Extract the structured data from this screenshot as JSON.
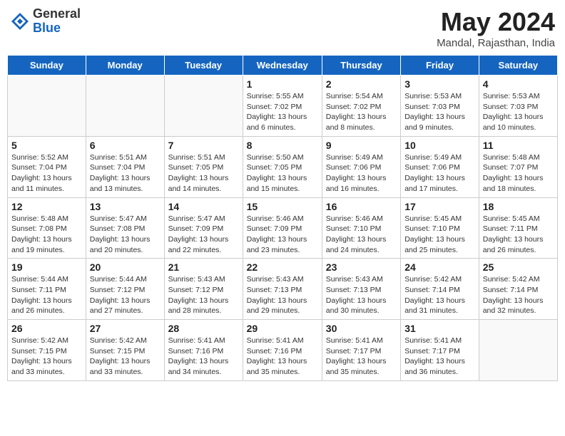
{
  "logo": {
    "general": "General",
    "blue": "Blue"
  },
  "header": {
    "month": "May 2024",
    "location": "Mandal, Rajasthan, India"
  },
  "weekdays": [
    "Sunday",
    "Monday",
    "Tuesday",
    "Wednesday",
    "Thursday",
    "Friday",
    "Saturday"
  ],
  "weeks": [
    [
      {
        "day": "",
        "info": ""
      },
      {
        "day": "",
        "info": ""
      },
      {
        "day": "",
        "info": ""
      },
      {
        "day": "1",
        "info": "Sunrise: 5:55 AM\nSunset: 7:02 PM\nDaylight: 13 hours\nand 6 minutes."
      },
      {
        "day": "2",
        "info": "Sunrise: 5:54 AM\nSunset: 7:02 PM\nDaylight: 13 hours\nand 8 minutes."
      },
      {
        "day": "3",
        "info": "Sunrise: 5:53 AM\nSunset: 7:03 PM\nDaylight: 13 hours\nand 9 minutes."
      },
      {
        "day": "4",
        "info": "Sunrise: 5:53 AM\nSunset: 7:03 PM\nDaylight: 13 hours\nand 10 minutes."
      }
    ],
    [
      {
        "day": "5",
        "info": "Sunrise: 5:52 AM\nSunset: 7:04 PM\nDaylight: 13 hours\nand 11 minutes."
      },
      {
        "day": "6",
        "info": "Sunrise: 5:51 AM\nSunset: 7:04 PM\nDaylight: 13 hours\nand 13 minutes."
      },
      {
        "day": "7",
        "info": "Sunrise: 5:51 AM\nSunset: 7:05 PM\nDaylight: 13 hours\nand 14 minutes."
      },
      {
        "day": "8",
        "info": "Sunrise: 5:50 AM\nSunset: 7:05 PM\nDaylight: 13 hours\nand 15 minutes."
      },
      {
        "day": "9",
        "info": "Sunrise: 5:49 AM\nSunset: 7:06 PM\nDaylight: 13 hours\nand 16 minutes."
      },
      {
        "day": "10",
        "info": "Sunrise: 5:49 AM\nSunset: 7:06 PM\nDaylight: 13 hours\nand 17 minutes."
      },
      {
        "day": "11",
        "info": "Sunrise: 5:48 AM\nSunset: 7:07 PM\nDaylight: 13 hours\nand 18 minutes."
      }
    ],
    [
      {
        "day": "12",
        "info": "Sunrise: 5:48 AM\nSunset: 7:08 PM\nDaylight: 13 hours\nand 19 minutes."
      },
      {
        "day": "13",
        "info": "Sunrise: 5:47 AM\nSunset: 7:08 PM\nDaylight: 13 hours\nand 20 minutes."
      },
      {
        "day": "14",
        "info": "Sunrise: 5:47 AM\nSunset: 7:09 PM\nDaylight: 13 hours\nand 22 minutes."
      },
      {
        "day": "15",
        "info": "Sunrise: 5:46 AM\nSunset: 7:09 PM\nDaylight: 13 hours\nand 23 minutes."
      },
      {
        "day": "16",
        "info": "Sunrise: 5:46 AM\nSunset: 7:10 PM\nDaylight: 13 hours\nand 24 minutes."
      },
      {
        "day": "17",
        "info": "Sunrise: 5:45 AM\nSunset: 7:10 PM\nDaylight: 13 hours\nand 25 minutes."
      },
      {
        "day": "18",
        "info": "Sunrise: 5:45 AM\nSunset: 7:11 PM\nDaylight: 13 hours\nand 26 minutes."
      }
    ],
    [
      {
        "day": "19",
        "info": "Sunrise: 5:44 AM\nSunset: 7:11 PM\nDaylight: 13 hours\nand 26 minutes."
      },
      {
        "day": "20",
        "info": "Sunrise: 5:44 AM\nSunset: 7:12 PM\nDaylight: 13 hours\nand 27 minutes."
      },
      {
        "day": "21",
        "info": "Sunrise: 5:43 AM\nSunset: 7:12 PM\nDaylight: 13 hours\nand 28 minutes."
      },
      {
        "day": "22",
        "info": "Sunrise: 5:43 AM\nSunset: 7:13 PM\nDaylight: 13 hours\nand 29 minutes."
      },
      {
        "day": "23",
        "info": "Sunrise: 5:43 AM\nSunset: 7:13 PM\nDaylight: 13 hours\nand 30 minutes."
      },
      {
        "day": "24",
        "info": "Sunrise: 5:42 AM\nSunset: 7:14 PM\nDaylight: 13 hours\nand 31 minutes."
      },
      {
        "day": "25",
        "info": "Sunrise: 5:42 AM\nSunset: 7:14 PM\nDaylight: 13 hours\nand 32 minutes."
      }
    ],
    [
      {
        "day": "26",
        "info": "Sunrise: 5:42 AM\nSunset: 7:15 PM\nDaylight: 13 hours\nand 33 minutes."
      },
      {
        "day": "27",
        "info": "Sunrise: 5:42 AM\nSunset: 7:15 PM\nDaylight: 13 hours\nand 33 minutes."
      },
      {
        "day": "28",
        "info": "Sunrise: 5:41 AM\nSunset: 7:16 PM\nDaylight: 13 hours\nand 34 minutes."
      },
      {
        "day": "29",
        "info": "Sunrise: 5:41 AM\nSunset: 7:16 PM\nDaylight: 13 hours\nand 35 minutes."
      },
      {
        "day": "30",
        "info": "Sunrise: 5:41 AM\nSunset: 7:17 PM\nDaylight: 13 hours\nand 35 minutes."
      },
      {
        "day": "31",
        "info": "Sunrise: 5:41 AM\nSunset: 7:17 PM\nDaylight: 13 hours\nand 36 minutes."
      },
      {
        "day": "",
        "info": ""
      }
    ]
  ]
}
